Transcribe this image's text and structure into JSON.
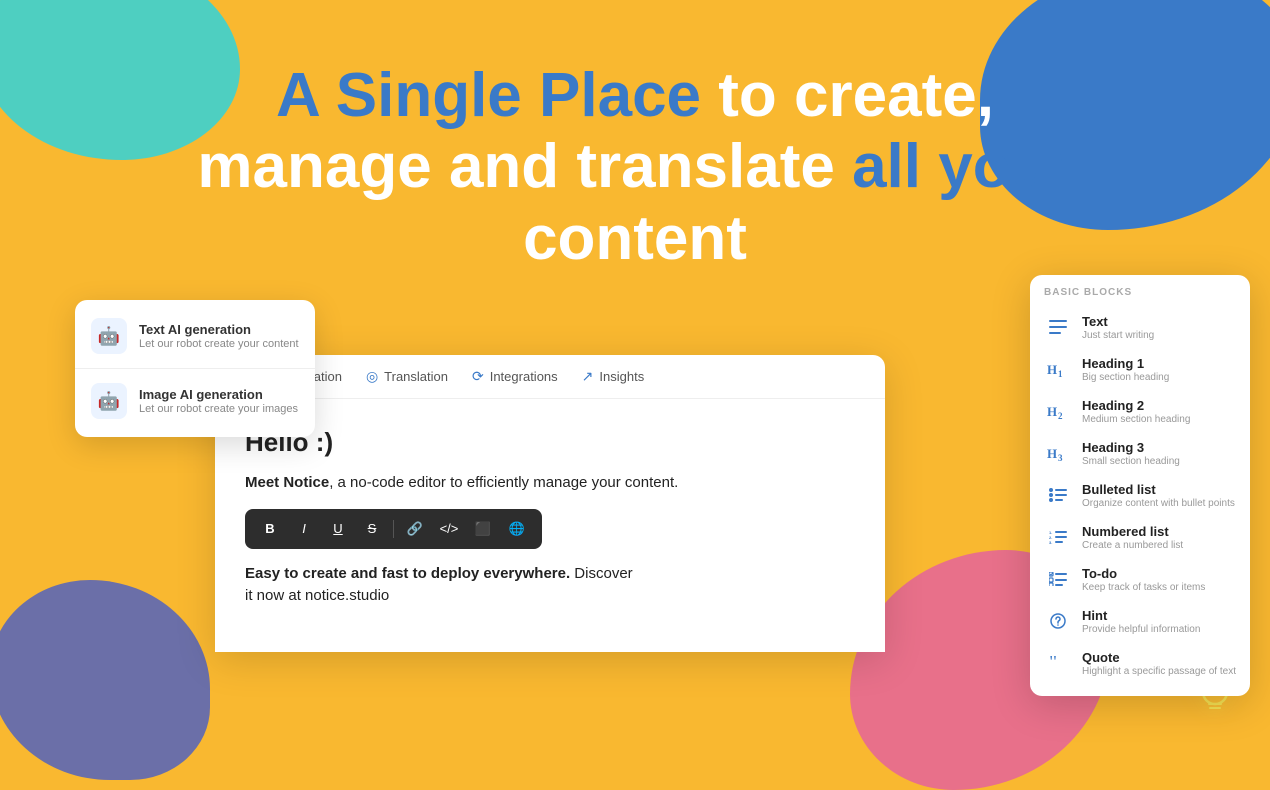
{
  "background_color": "#F9B830",
  "blobs": {
    "teal": "#4ECFC1",
    "blue": "#3A7AC8",
    "purple": "#6B6FA8",
    "pink": "#E8708A"
  },
  "headline": {
    "part1": "A Single Place",
    "part2": " to create,",
    "part3": "manage and translate ",
    "part4": "all your",
    "part5": "content"
  },
  "ai_popup": {
    "items": [
      {
        "title": "Text AI generation",
        "subtitle": "Let our robot create your content"
      },
      {
        "title": "Image AI generation",
        "subtitle": "Let our robot create your images"
      }
    ]
  },
  "editor": {
    "tabs": [
      {
        "label": "Customization",
        "icon": "⚙"
      },
      {
        "label": "Translation",
        "icon": "◎"
      },
      {
        "label": "Integrations",
        "icon": "⟳"
      },
      {
        "label": "Insights",
        "icon": "↗"
      }
    ],
    "heading": "Hello :)",
    "paragraph1_prefix": "Meet Notice",
    "paragraph1_rest": ", a no-code editor to efficiently manage your content.",
    "toolbar_buttons": [
      "B",
      "I",
      "U",
      "S",
      "🔗",
      "</>",
      "⬛",
      "🌐"
    ],
    "highlight_text": "Easy to create and fast to deploy everywhere.",
    "highlight_rest": " Discover\nit now at notice.studio"
  },
  "blocks_panel": {
    "header": "BASIC BLOCKS",
    "items": [
      {
        "icon": "≡",
        "title": "Text",
        "desc": "Just start writing"
      },
      {
        "icon": "H₁",
        "title": "Heading 1",
        "desc": "Big section heading"
      },
      {
        "icon": "H₂",
        "title": "Heading 2",
        "desc": "Medium section heading"
      },
      {
        "icon": "H₃",
        "title": "Heading 3",
        "desc": "Small section heading"
      },
      {
        "icon": "•≡",
        "title": "Bulleted list",
        "desc": "Organize content with bullet points"
      },
      {
        "icon": "1≡",
        "title": "Numbered list",
        "desc": "Create a numbered list"
      },
      {
        "icon": "✓≡",
        "title": "To-do",
        "desc": "Keep track of tasks or items"
      },
      {
        "icon": "💡",
        "title": "Hint",
        "desc": "Provide helpful information"
      },
      {
        "icon": "❝",
        "title": "Quote",
        "desc": "Highlight a specific passage of text"
      }
    ]
  }
}
